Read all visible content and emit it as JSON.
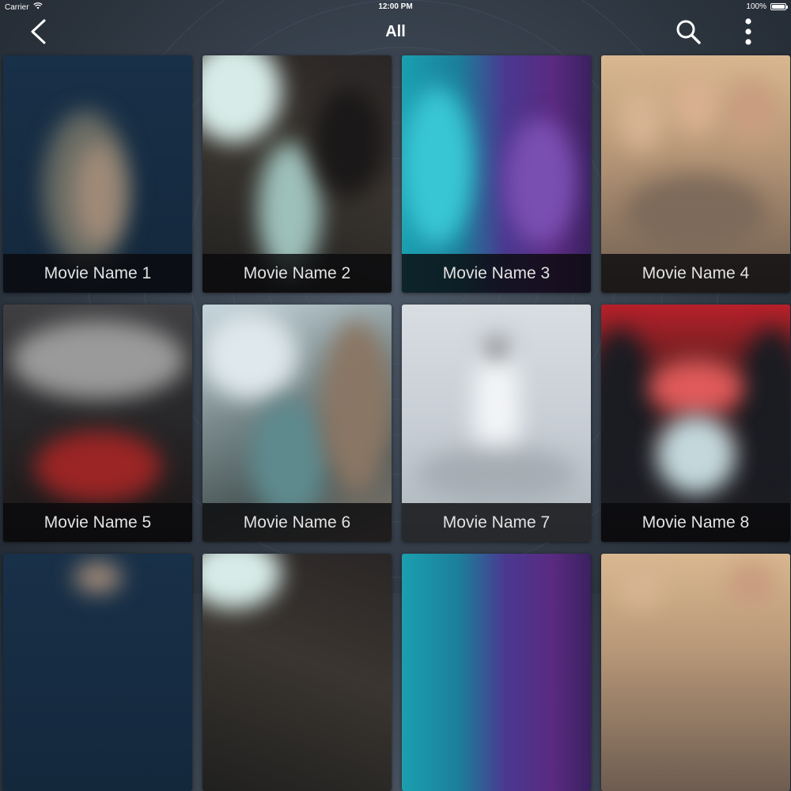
{
  "status_bar": {
    "carrier": "Carrier",
    "time": "12:00 PM",
    "battery": "100%"
  },
  "nav": {
    "title": "All",
    "back_icon": "chevron-left-icon",
    "search_icon": "search-icon",
    "more_icon": "more-vertical-icon"
  },
  "movies": [
    {
      "title": "Movie Name 1"
    },
    {
      "title": "Movie Name 2"
    },
    {
      "title": "Movie Name 3"
    },
    {
      "title": "Movie Name 4"
    },
    {
      "title": "Movie Name 5"
    },
    {
      "title": "Movie Name 6"
    },
    {
      "title": "Movie Name 7"
    },
    {
      "title": "Movie Name 8"
    },
    {
      "title": ""
    },
    {
      "title": ""
    },
    {
      "title": ""
    },
    {
      "title": ""
    }
  ]
}
